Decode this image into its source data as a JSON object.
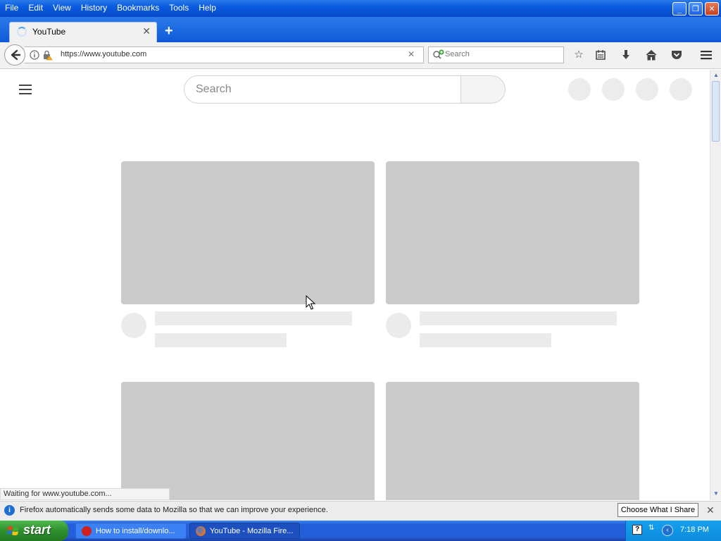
{
  "menu": [
    "File",
    "Edit",
    "View",
    "History",
    "Bookmarks",
    "Tools",
    "Help"
  ],
  "window_controls": {
    "minimize": "_",
    "restore": "❐",
    "close": "✕"
  },
  "tab": {
    "title": "YouTube",
    "close": "✕"
  },
  "new_tab": "+",
  "url": "https://www.youtube.com",
  "url_clear": "✕",
  "browser_search_placeholder": "Search",
  "toolbar_icons": [
    "star-icon",
    "reading-list-icon",
    "download-icon",
    "home-icon",
    "pocket-icon",
    "menu-icon"
  ],
  "page": {
    "search_placeholder": "Search"
  },
  "status_text": "Waiting for www.youtube.com...",
  "notification": {
    "text": "Firefox automatically sends some data to Mozilla so that we can improve your experience.",
    "button": "Choose What I Share",
    "close": "✕",
    "info": "i"
  },
  "taskbar": {
    "start": "start",
    "tasks": [
      {
        "label": "How to install/downlo...",
        "active": false
      },
      {
        "label": "YouTube - Mozilla Fire...",
        "active": true
      }
    ],
    "clock": "7:18 PM"
  }
}
